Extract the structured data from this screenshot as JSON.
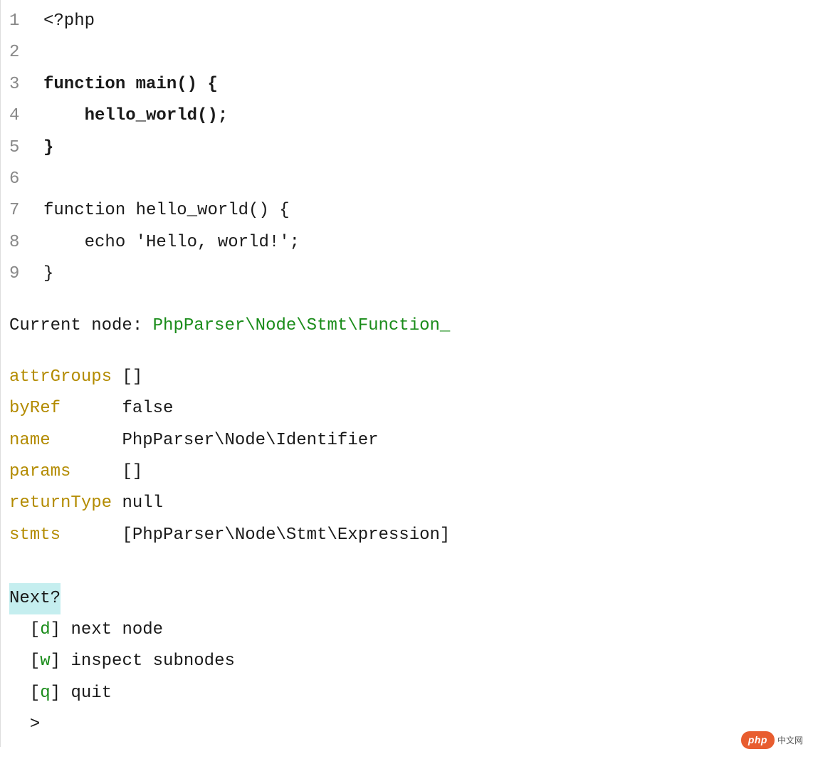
{
  "code": {
    "lines": [
      {
        "no": "1",
        "text": "<?php",
        "bold": false
      },
      {
        "no": "2",
        "text": "",
        "bold": false
      },
      {
        "no": "3",
        "text": "function main() {",
        "bold": true
      },
      {
        "no": "4",
        "text": "    hello_world();",
        "bold": true
      },
      {
        "no": "5",
        "text": "}",
        "bold": true
      },
      {
        "no": "6",
        "text": "",
        "bold": false
      },
      {
        "no": "7",
        "text": "function hello_world() {",
        "bold": false
      },
      {
        "no": "8",
        "text": "    echo 'Hello, world!';",
        "bold": false
      },
      {
        "no": "9",
        "text": "}",
        "bold": false
      }
    ]
  },
  "currentNode": {
    "label": "Current node: ",
    "value": "PhpParser\\Node\\Stmt\\Function_"
  },
  "attrs": [
    {
      "key": "attrGroups",
      "value": "[]"
    },
    {
      "key": "byRef",
      "value": "false"
    },
    {
      "key": "name",
      "value": "PhpParser\\Node\\Identifier"
    },
    {
      "key": "params",
      "value": "[]"
    },
    {
      "key": "returnType",
      "value": "null"
    },
    {
      "key": "stmts",
      "value": "[PhpParser\\Node\\Stmt\\Expression]"
    }
  ],
  "attrKeyWidth": 11,
  "prompt": {
    "label": "Next?",
    "options": [
      {
        "key": "d",
        "label": "next node"
      },
      {
        "key": "w",
        "label": "inspect subnodes"
      },
      {
        "key": "q",
        "label": "quit"
      }
    ],
    "cursor": "> "
  },
  "footer": {
    "badge": "php",
    "text": "中文网"
  }
}
